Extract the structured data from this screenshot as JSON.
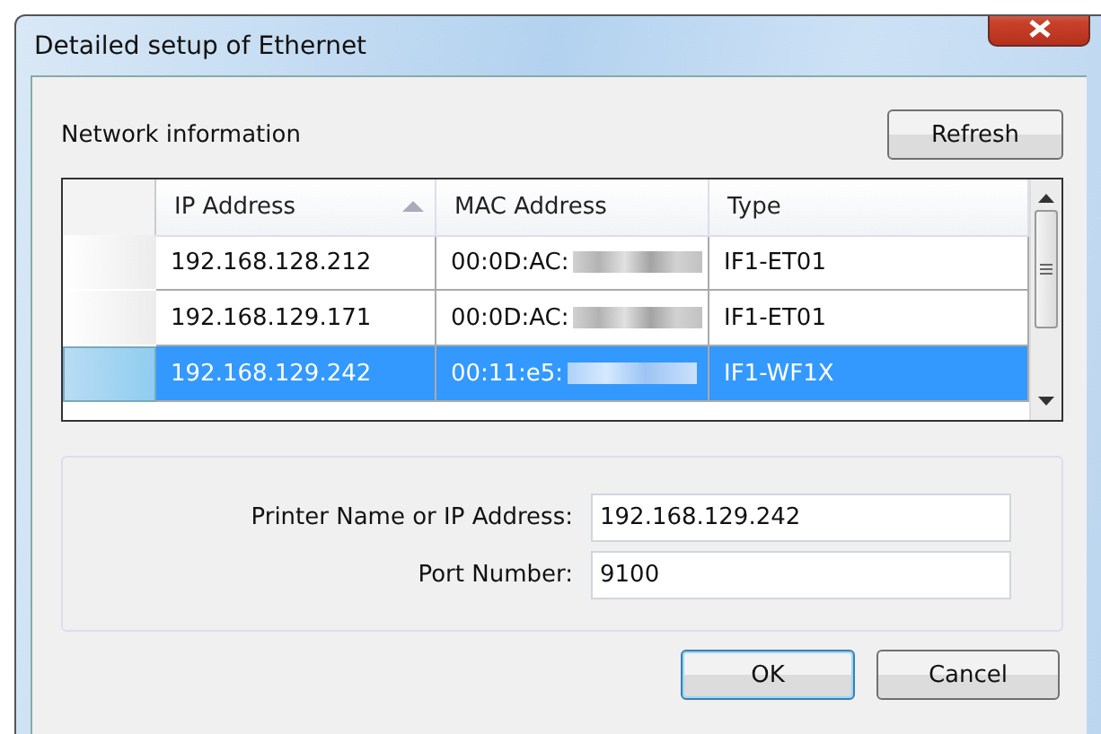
{
  "window": {
    "title": "Detailed setup of Ethernet"
  },
  "network_information": {
    "label": "Network information",
    "refresh_button": "Refresh"
  },
  "table": {
    "columns": [
      {
        "label": "IP Address",
        "sorted": true
      },
      {
        "label": "MAC Address",
        "sorted": false
      },
      {
        "label": "Type",
        "sorted": false
      }
    ],
    "rows": [
      {
        "ip": "192.168.128.212",
        "mac": "00:0D:AC:",
        "type": "IF1-ET01",
        "selected": false
      },
      {
        "ip": "192.168.129.171",
        "mac": "00:0D:AC:",
        "type": "IF1-ET01",
        "selected": false
      },
      {
        "ip": "192.168.129.242",
        "mac": "00:11:e5:",
        "type": "IF1-WF1X",
        "selected": true
      }
    ]
  },
  "form": {
    "fields": [
      {
        "label": "Printer Name or IP Address:",
        "value": "192.168.129.242"
      },
      {
        "label": "Port Number:",
        "value": "9100"
      }
    ]
  },
  "buttons": [
    {
      "label": "OK",
      "kind": "default"
    },
    {
      "label": "Cancel",
      "kind": "normal"
    }
  ]
}
